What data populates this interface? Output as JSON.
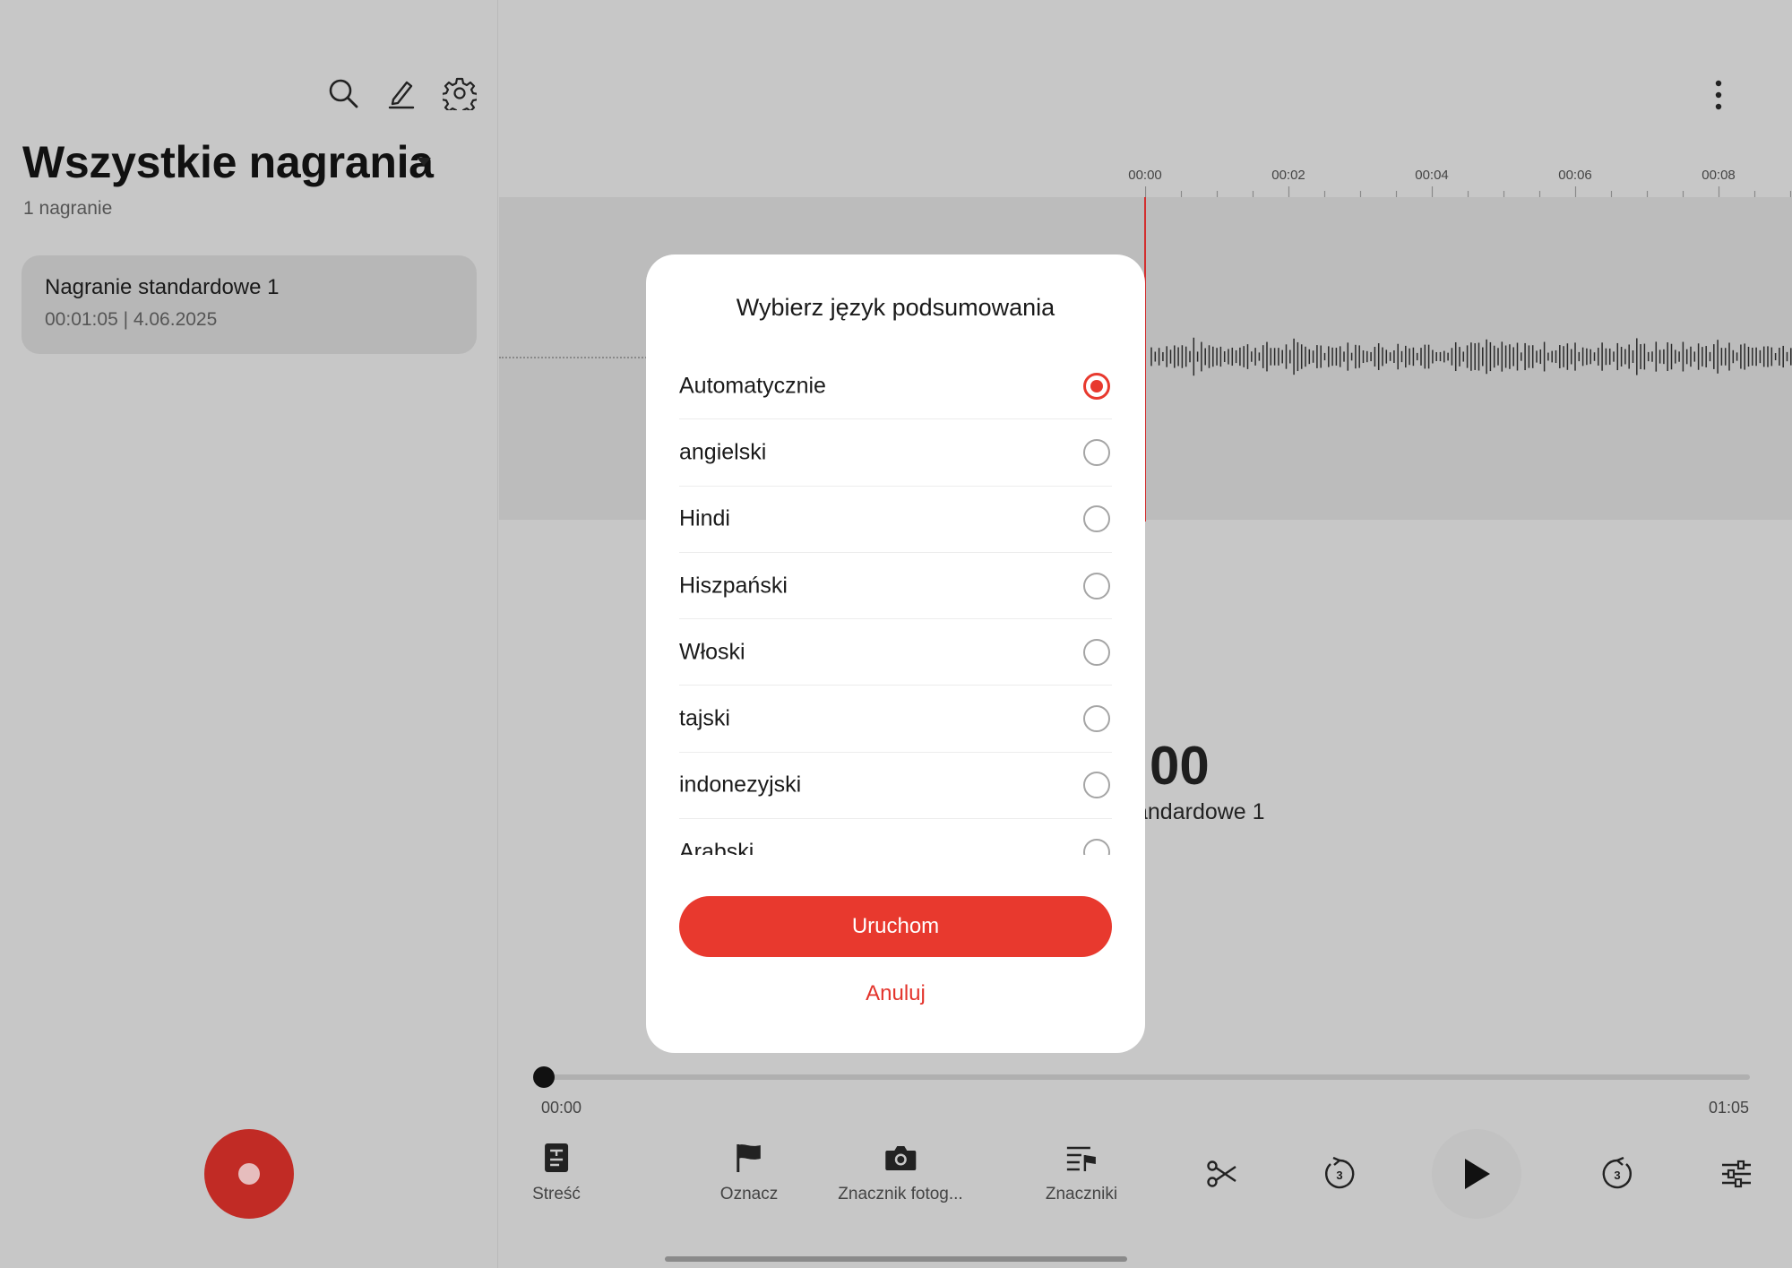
{
  "sidebar": {
    "title": "Wszystkie nagrania",
    "count": "1 nagranie",
    "recordings": [
      {
        "name": "Nagranie standardowe 1",
        "meta": "00:01:05 | 4.06.2025"
      }
    ]
  },
  "timeline": {
    "ticks": [
      "00:00",
      "00:02",
      "00:04",
      "00:06",
      "00:08"
    ]
  },
  "player": {
    "time": ":00",
    "name": "andardowe 1",
    "position_start": "00:00",
    "duration": "01:05",
    "progress": 0
  },
  "toolbar": {
    "summary": "Streść",
    "mark": "Oznacz",
    "photo_marker": "Znacznik fotog...",
    "markers": "Znaczniki"
  },
  "dialog": {
    "title": "Wybierz język podsumowania",
    "options": [
      "Automatycznie",
      "angielski",
      "Hindi",
      "Hiszpański",
      "Włoski",
      "tajski",
      "indonezyjski",
      "Arabski"
    ],
    "selected": "Automatycznie",
    "start_label": "Uruchom",
    "cancel_label": "Anuluj"
  },
  "colors": {
    "accent": "#e8392e",
    "record": "#c12b25",
    "backdrop": "#c7c7c7"
  }
}
